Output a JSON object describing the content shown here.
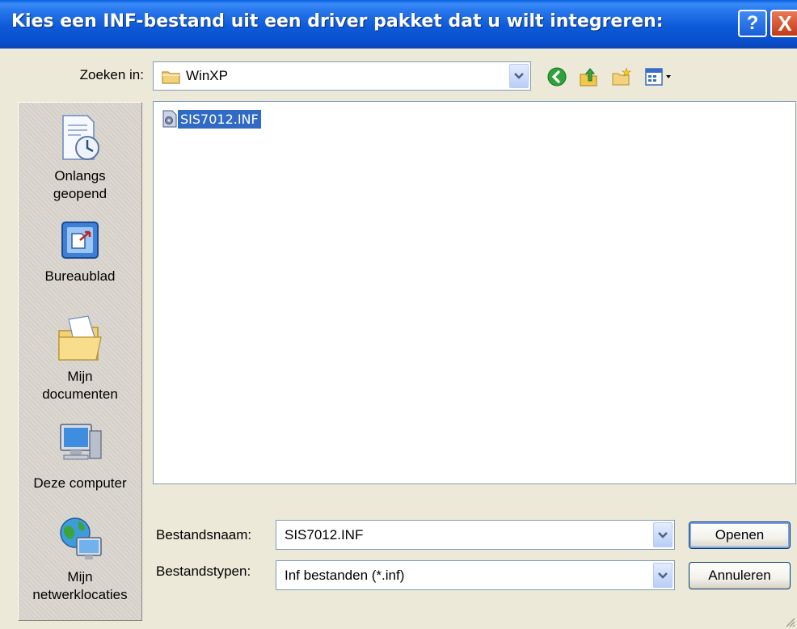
{
  "window": {
    "title": "Kies een INF-bestand uit een driver pakket dat u wilt integreren:",
    "help_glyph": "?",
    "close_glyph": "X"
  },
  "lookin": {
    "label": "Zoeken in:",
    "value": "WinXP",
    "folder_icon": "folder-icon",
    "dropdown_icon": "chevron-down-icon"
  },
  "toolbar": {
    "icons": [
      "back-icon",
      "up-folder-icon",
      "new-folder-icon",
      "view-menu-icon"
    ]
  },
  "places": {
    "items": [
      {
        "label": "Onlangs geopend",
        "icon": "recent-documents-icon"
      },
      {
        "label": "Bureaublad",
        "icon": "desktop-icon"
      },
      {
        "label": "Mijn documenten",
        "icon": "my-documents-icon"
      },
      {
        "label": "Deze computer",
        "icon": "my-computer-icon"
      },
      {
        "label": "Mijn netwerklocaties",
        "icon": "network-places-icon"
      }
    ]
  },
  "files": {
    "items": [
      {
        "name": "SIS7012.INF",
        "selected": true,
        "icon": "inf-file-icon"
      }
    ]
  },
  "fields": {
    "filename_label": "Bestandsnaam:",
    "filename_value": "SIS7012.INF",
    "filetype_label": "Bestandstypen:",
    "filetype_value": "Inf bestanden (*.inf)"
  },
  "buttons": {
    "open": "Openen",
    "cancel": "Annuleren"
  },
  "colors": {
    "titlebar": "#0a5fe0",
    "selection": "#316ac5",
    "dialog_bg": "#ece9d8"
  }
}
